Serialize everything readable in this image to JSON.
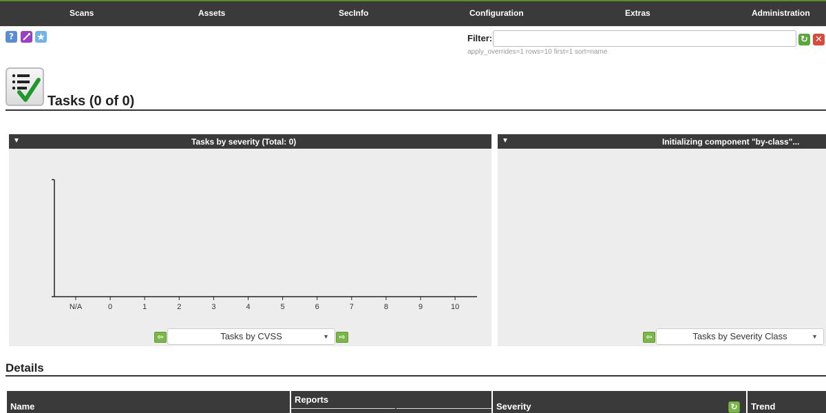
{
  "nav": {
    "items": [
      {
        "label": "Scans"
      },
      {
        "label": "Assets"
      },
      {
        "label": "SecInfo"
      },
      {
        "label": "Configuration"
      },
      {
        "label": "Extras"
      },
      {
        "label": "Administration"
      }
    ]
  },
  "toolbar": {
    "help_icon": "help-icon",
    "new_task_icon": "new-task-wizard-icon",
    "new_icon": "new-icon"
  },
  "filter": {
    "label": "Filter:",
    "value": "",
    "params": "apply_overrides=1 rows=10 first=1 sort=name"
  },
  "page": {
    "title": "Tasks (0 of 0)"
  },
  "charts": {
    "left": {
      "title": "Tasks by severity (Total: 0)",
      "selected": "Tasks by CVSS"
    },
    "right": {
      "title": "Initializing component \"by-class\"...",
      "selected": "Tasks by Severity Class"
    }
  },
  "chart_data": {
    "type": "bar",
    "categories": [
      "N/A",
      "0",
      "1",
      "2",
      "3",
      "4",
      "5",
      "6",
      "7",
      "8",
      "9",
      "10"
    ],
    "values": [
      0,
      0,
      0,
      0,
      0,
      0,
      0,
      0,
      0,
      0,
      0,
      0
    ],
    "title": "Tasks by severity (Total: 0)",
    "xlabel": "",
    "ylabel": ""
  },
  "details": {
    "title": "Details",
    "columns": {
      "name": "Name",
      "reports": "Reports",
      "severity": "Severity",
      "trend": "Trend"
    }
  },
  "colors": {
    "header_bg": "#3a3a3a",
    "accent_green": "#7ab648",
    "panel_bg": "#ededed"
  }
}
